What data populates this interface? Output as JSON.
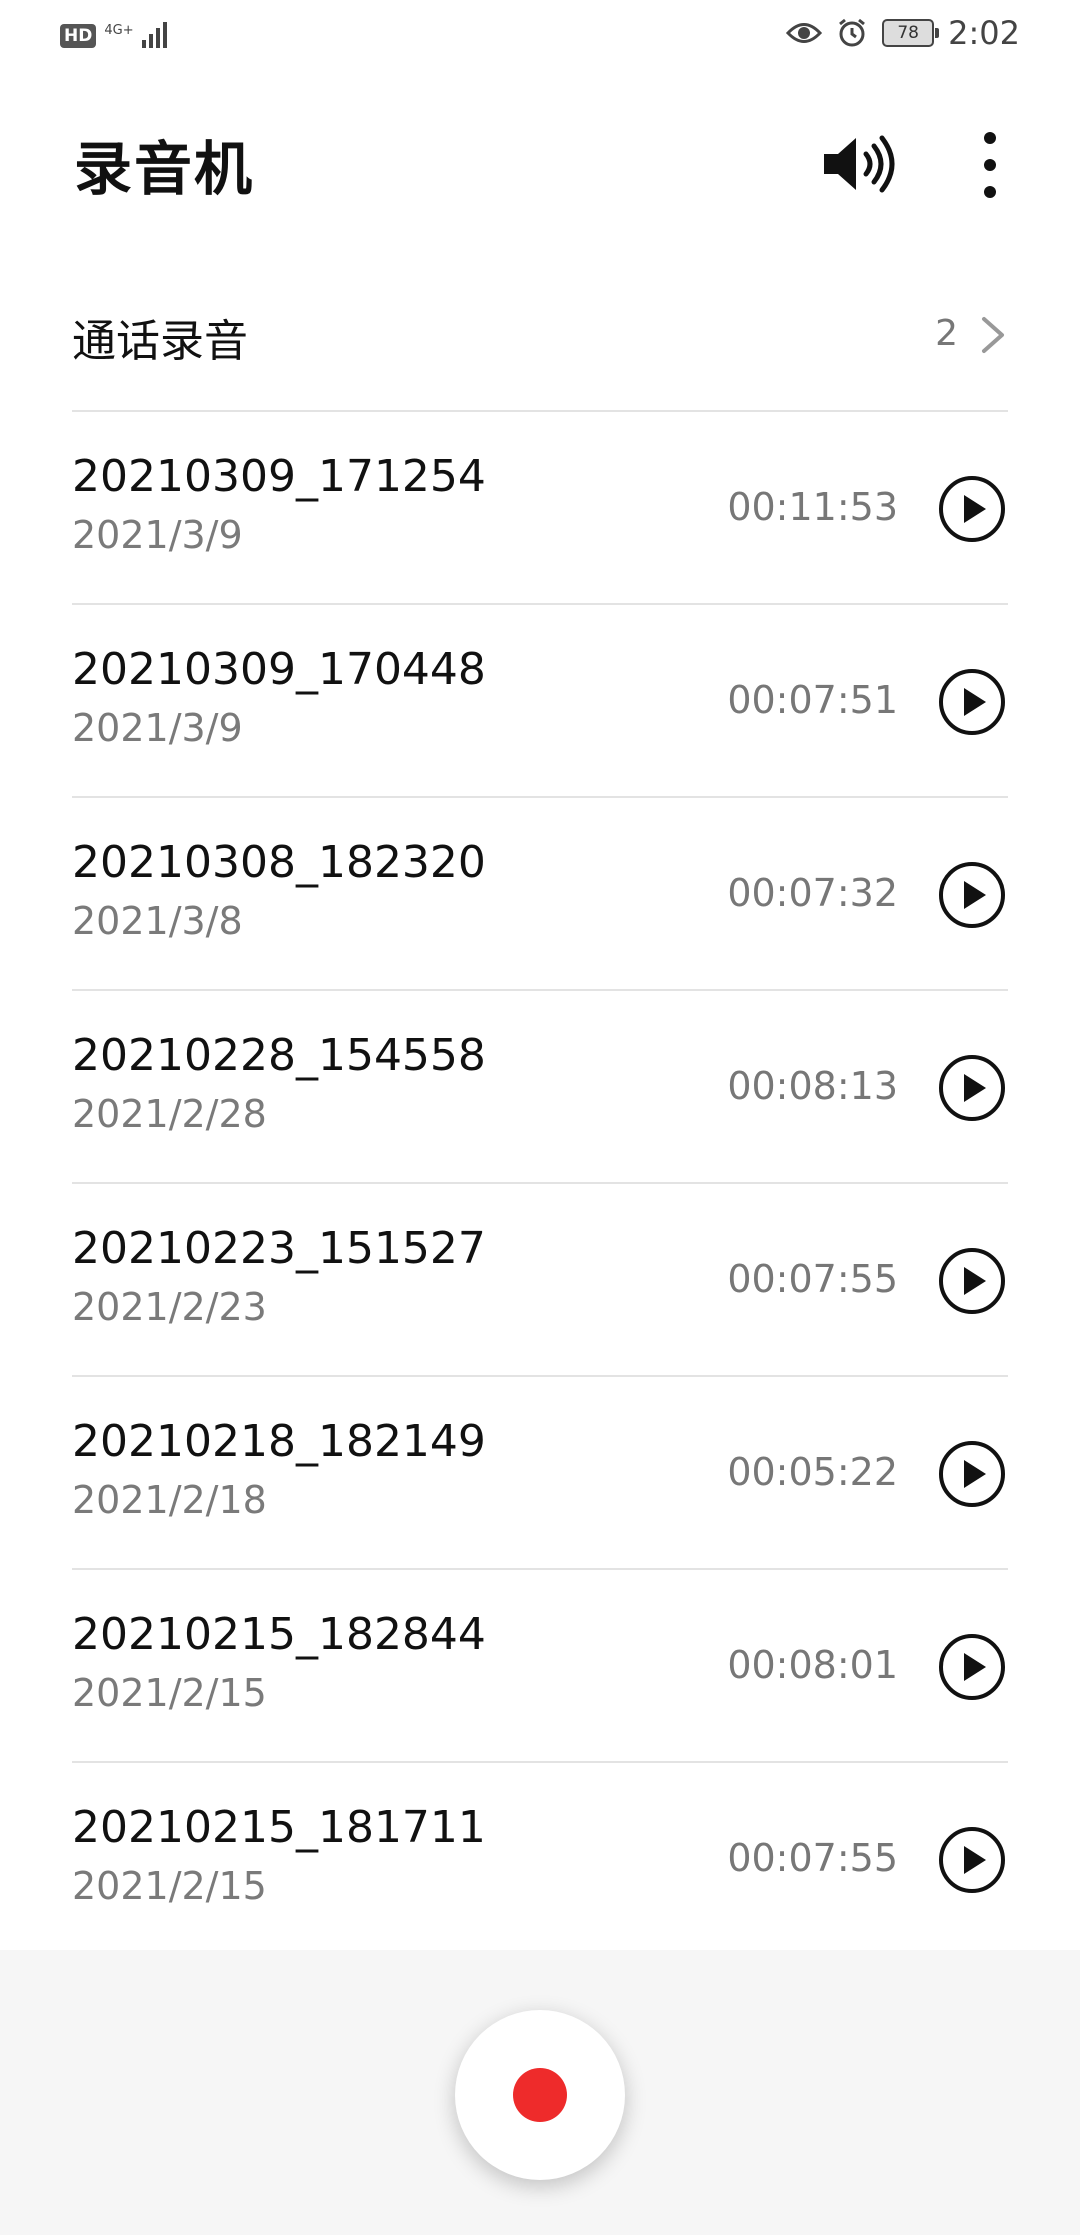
{
  "status_bar": {
    "hd_label": "HD",
    "network_label": "4G+",
    "battery": "78",
    "time": "2:02"
  },
  "header": {
    "title": "录音机",
    "speaker_icon": "speaker-icon",
    "more_icon": "more-vertical-icon"
  },
  "call_recordings": {
    "label": "通话录音",
    "count": "2"
  },
  "recordings": [
    {
      "name": "20210309_171254",
      "date": "2021/3/9",
      "duration": "00:11:53"
    },
    {
      "name": "20210309_170448",
      "date": "2021/3/9",
      "duration": "00:07:51"
    },
    {
      "name": "20210308_182320",
      "date": "2021/3/8",
      "duration": "00:07:32"
    },
    {
      "name": "20210228_154558",
      "date": "2021/2/28",
      "duration": "00:08:13"
    },
    {
      "name": "20210223_151527",
      "date": "2021/2/23",
      "duration": "00:07:55"
    },
    {
      "name": "20210218_182149",
      "date": "2021/2/18",
      "duration": "00:05:22"
    },
    {
      "name": "20210215_182844",
      "date": "2021/2/15",
      "duration": "00:08:01"
    },
    {
      "name": "20210215_181711",
      "date": "2021/2/15",
      "duration": "00:07:55"
    }
  ],
  "colors": {
    "record_button": "#ee2b2b",
    "divider": "#e3e3e3",
    "secondary_text": "#7a7a7a"
  }
}
